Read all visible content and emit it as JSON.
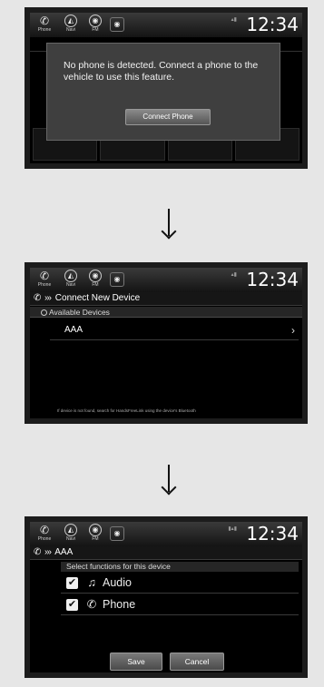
{
  "statusbar": {
    "phone_label": "Phone",
    "navi_label": "Navi",
    "fm_label": "FM",
    "clock": "12:34"
  },
  "screen1": {
    "dialog_message": "No phone is detected. Connect a phone to the vehicle to use this feature.",
    "connect_button": "Connect Phone"
  },
  "screen2": {
    "header_title": "Connect New Device",
    "subheader": "Available Devices",
    "device_name": "AAA",
    "footnote": "If device is not found, search for HandsFreeLink using the device's Bluetooth"
  },
  "screen3": {
    "header_title": "AAA",
    "select_label": "Select functions for this device",
    "functions": [
      {
        "label": "Audio",
        "icon": "music-note-icon",
        "checked": true
      },
      {
        "label": "Phone",
        "icon": "phone-icon",
        "checked": true
      }
    ],
    "save_button": "Save",
    "cancel_button": "Cancel"
  }
}
